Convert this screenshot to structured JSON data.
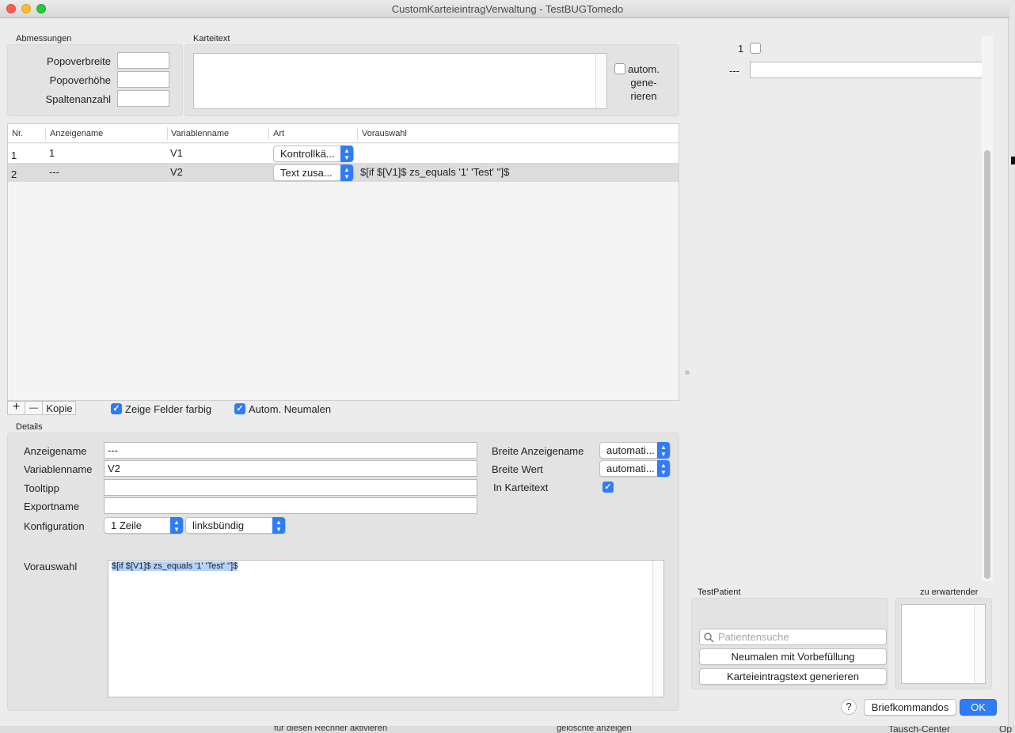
{
  "window": {
    "title": "CustomKarteieintragVerwaltung - TestBUGTomedo"
  },
  "abmessungen": {
    "section": "Abmessungen",
    "popoverbreite": "Popoverbreite",
    "popoverhoehe": "Popoverhöhe",
    "spaltenanzahl": "Spaltenanzahl"
  },
  "karteitext": {
    "section": "Karteitext",
    "autom_line1": "autom.",
    "autom_line2": "gene-",
    "autom_line3": "rieren"
  },
  "table": {
    "headers": [
      "Nr.",
      "Anzeigename",
      "Variablenname",
      "Art",
      "Vorauswahl"
    ],
    "rows": [
      {
        "nr": "1",
        "anzeige": "1",
        "variable": "V1",
        "art": "Kontrollkä...",
        "vorauswahl": ""
      },
      {
        "nr": "2",
        "anzeige": "---",
        "variable": "V2",
        "art": "Text zusa...",
        "vorauswahl": "$[if $[V1]$ zs_equals '1' 'Test' '']$"
      }
    ]
  },
  "toolbar": {
    "add": "+",
    "remove": "—",
    "copy": "Kopie",
    "zeige_felder": "Zeige Felder farbig",
    "autom_neumalen": "Autom. Neumalen"
  },
  "details": {
    "section": "Details",
    "anzeigename_label": "Anzeigename",
    "anzeigename_value": "---",
    "variablenname_label": "Variablenname",
    "variablenname_value": "V2",
    "tooltipp_label": "Tooltipp",
    "exportname_label": "Exportname",
    "konfiguration_label": "Konfiguration",
    "konfig_zeilen": "1 Zeile",
    "konfig_ausrichtung": "linksbündig",
    "breite_anzeigename_label": "Breite Anzeigename",
    "breite_anzeigename_value": "automati...",
    "breite_wert_label": "Breite Wert",
    "breite_wert_value": "automati...",
    "in_karteitext_label": "In Karteitext",
    "vorauswahl_label": "Vorauswahl",
    "vorauswahl_value": "$[if $[V1]$ zs_equals '1' 'Test' '']$"
  },
  "preview": {
    "row1_label": "1",
    "row2_label": "---"
  },
  "testpatient": {
    "section": "TestPatient",
    "search_placeholder": "Patientensuche",
    "neumalen_button": "Neumalen mit Vorbefüllung",
    "generieren_button": "Karteieintragstext generieren",
    "zu_erwartender": "zu erwartender"
  },
  "footer": {
    "help": "?",
    "briefkommandos": "Briefkommandos",
    "ok": "OK"
  },
  "background_window": {
    "item1": "für diesen Rechner aktivieren",
    "item2": "gelöschte anzeigen",
    "item3": "Tausch-Center",
    "item4": "Op"
  },
  "colors": {
    "accent": "#2e7cf6",
    "selected_row": "#dcdcdc",
    "highlight": "#b3d3fd"
  }
}
